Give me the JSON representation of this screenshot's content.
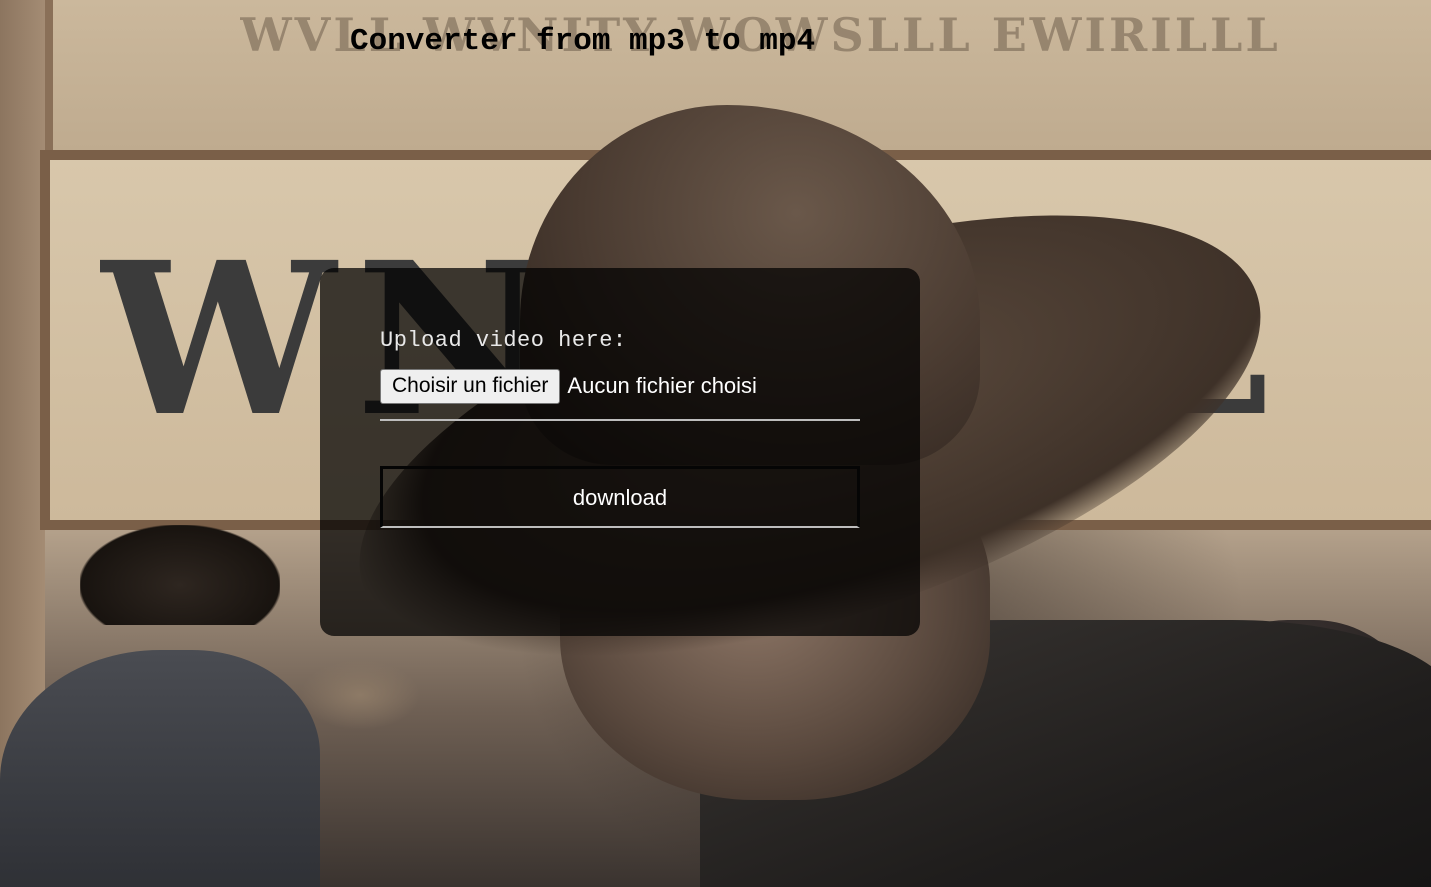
{
  "page": {
    "title": "Converter from mp3 to mp4"
  },
  "form": {
    "upload_label": "Upload video here:",
    "file_button_label": "Choisir un fichier",
    "file_status": "Aucun fichier choisi",
    "download_label": "download"
  },
  "background": {
    "description_icon": "western-cowboy-illustration"
  }
}
